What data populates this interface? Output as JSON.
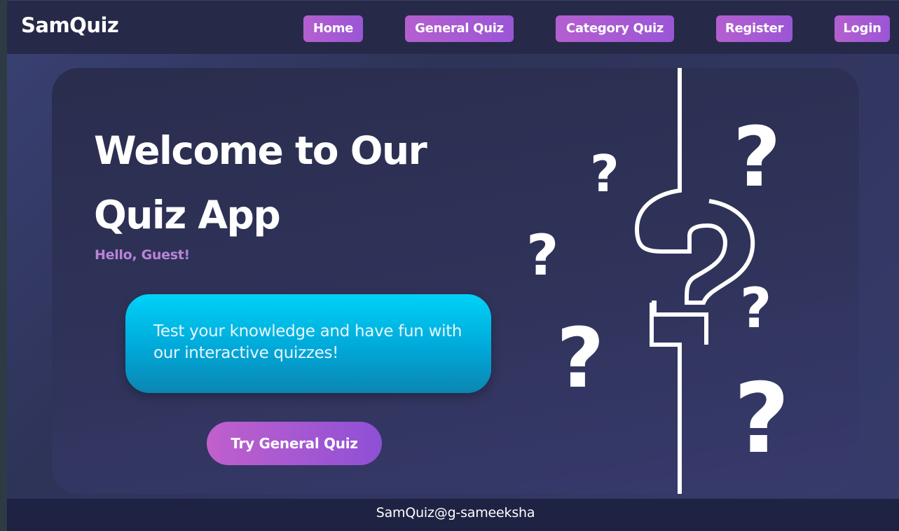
{
  "navbar": {
    "brand": "SamQuiz",
    "links": [
      {
        "label": "Home"
      },
      {
        "label": "General Quiz"
      },
      {
        "label": "Category Quiz"
      },
      {
        "label": "Register"
      },
      {
        "label": "Login"
      }
    ]
  },
  "hero": {
    "headline_line1": "Welcome to Our",
    "headline_line2": "Quiz App",
    "greeting": "Hello, Guest!",
    "info_text": "Test your knowledge and have fun with our interactive quizzes!",
    "cta_label": "Try General Quiz",
    "illustration_icon": "question-marks-illustration"
  },
  "footer": {
    "text": "SamQuiz@g-sameeksha"
  },
  "colors": {
    "accent_purple": "#a95bd2",
    "cyan": "#00c6f0",
    "navbar_bg": "#262a48",
    "footer_bg": "#1e2243",
    "greeting": "#b883d8"
  }
}
